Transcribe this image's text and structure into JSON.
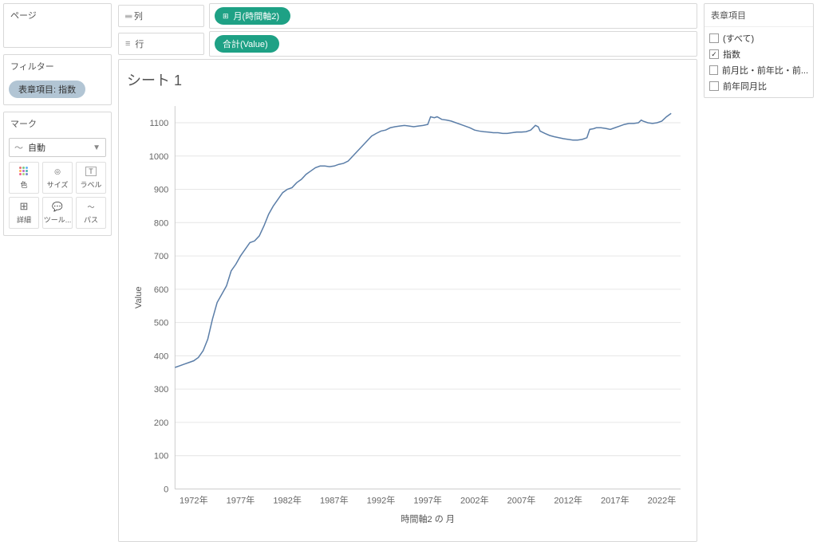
{
  "left": {
    "pages_title": "ページ",
    "filters_title": "フィルター",
    "filter_value": "表章項目: 指数",
    "marks_title": "マーク",
    "marks_select_label": "自動",
    "marks_cells": [
      "色",
      "サイズ",
      "ラベル",
      "詳細",
      "ツール...",
      "パス"
    ]
  },
  "shelves": {
    "columns_label": "列",
    "columns_pill": "月(時間軸2)",
    "rows_label": "行",
    "rows_pill": "合計(Value)"
  },
  "sheet": {
    "title": "シート 1",
    "yaxis": "Value",
    "xaxis": "時間軸2 の 月"
  },
  "legend": {
    "title": "表章項目",
    "items": [
      {
        "label": "(すべて)",
        "checked": false
      },
      {
        "label": "指数",
        "checked": true
      },
      {
        "label": "前月比・前年比・前...",
        "checked": false
      },
      {
        "label": "前年同月比",
        "checked": false
      }
    ]
  },
  "chart_data": {
    "type": "line",
    "ylabel": "Value",
    "xlabel": "時間軸2 の 月",
    "ylim": [
      0,
      1150
    ],
    "yticks": [
      0,
      100,
      200,
      300,
      400,
      500,
      600,
      700,
      800,
      900,
      1000,
      1100
    ],
    "xticks": [
      "1972年",
      "1977年",
      "1982年",
      "1987年",
      "1992年",
      "1997年",
      "2002年",
      "2007年",
      "2012年",
      "2017年",
      "2022年"
    ],
    "x_start_year": 1970,
    "x_end_year": 2024,
    "series": [
      {
        "name": "指数",
        "color": "#5b7ea8",
        "points": [
          {
            "year": 1970.0,
            "val": 365
          },
          {
            "year": 1970.5,
            "val": 370
          },
          {
            "year": 1971.0,
            "val": 375
          },
          {
            "year": 1971.5,
            "val": 380
          },
          {
            "year": 1972.0,
            "val": 385
          },
          {
            "year": 1972.5,
            "val": 395
          },
          {
            "year": 1973.0,
            "val": 415
          },
          {
            "year": 1973.5,
            "val": 450
          },
          {
            "year": 1974.0,
            "val": 510
          },
          {
            "year": 1974.5,
            "val": 560
          },
          {
            "year": 1975.0,
            "val": 585
          },
          {
            "year": 1975.5,
            "val": 610
          },
          {
            "year": 1976.0,
            "val": 655
          },
          {
            "year": 1976.5,
            "val": 675
          },
          {
            "year": 1977.0,
            "val": 700
          },
          {
            "year": 1977.5,
            "val": 720
          },
          {
            "year": 1978.0,
            "val": 740
          },
          {
            "year": 1978.5,
            "val": 745
          },
          {
            "year": 1979.0,
            "val": 760
          },
          {
            "year": 1979.5,
            "val": 790
          },
          {
            "year": 1980.0,
            "val": 825
          },
          {
            "year": 1980.5,
            "val": 850
          },
          {
            "year": 1981.0,
            "val": 870
          },
          {
            "year": 1981.5,
            "val": 890
          },
          {
            "year": 1982.0,
            "val": 900
          },
          {
            "year": 1982.5,
            "val": 905
          },
          {
            "year": 1983.0,
            "val": 920
          },
          {
            "year": 1983.5,
            "val": 930
          },
          {
            "year": 1984.0,
            "val": 945
          },
          {
            "year": 1984.5,
            "val": 955
          },
          {
            "year": 1985.0,
            "val": 965
          },
          {
            "year": 1985.5,
            "val": 970
          },
          {
            "year": 1986.0,
            "val": 970
          },
          {
            "year": 1986.5,
            "val": 968
          },
          {
            "year": 1987.0,
            "val": 970
          },
          {
            "year": 1987.5,
            "val": 975
          },
          {
            "year": 1988.0,
            "val": 978
          },
          {
            "year": 1988.5,
            "val": 985
          },
          {
            "year": 1989.0,
            "val": 1000
          },
          {
            "year": 1989.5,
            "val": 1015
          },
          {
            "year": 1990.0,
            "val": 1030
          },
          {
            "year": 1990.5,
            "val": 1045
          },
          {
            "year": 1991.0,
            "val": 1060
          },
          {
            "year": 1991.5,
            "val": 1068
          },
          {
            "year": 1992.0,
            "val": 1075
          },
          {
            "year": 1992.5,
            "val": 1078
          },
          {
            "year": 1993.0,
            "val": 1085
          },
          {
            "year": 1993.5,
            "val": 1088
          },
          {
            "year": 1994.0,
            "val": 1090
          },
          {
            "year": 1994.5,
            "val": 1092
          },
          {
            "year": 1995.0,
            "val": 1090
          },
          {
            "year": 1995.5,
            "val": 1088
          },
          {
            "year": 1996.0,
            "val": 1090
          },
          {
            "year": 1996.5,
            "val": 1092
          },
          {
            "year": 1997.0,
            "val": 1095
          },
          {
            "year": 1997.3,
            "val": 1118
          },
          {
            "year": 1997.7,
            "val": 1115
          },
          {
            "year": 1998.0,
            "val": 1118
          },
          {
            "year": 1998.5,
            "val": 1110
          },
          {
            "year": 1999.0,
            "val": 1108
          },
          {
            "year": 1999.5,
            "val": 1105
          },
          {
            "year": 2000.0,
            "val": 1100
          },
          {
            "year": 2000.5,
            "val": 1095
          },
          {
            "year": 2001.0,
            "val": 1090
          },
          {
            "year": 2001.5,
            "val": 1085
          },
          {
            "year": 2002.0,
            "val": 1078
          },
          {
            "year": 2002.5,
            "val": 1075
          },
          {
            "year": 2003.0,
            "val": 1073
          },
          {
            "year": 2003.5,
            "val": 1072
          },
          {
            "year": 2004.0,
            "val": 1070
          },
          {
            "year": 2004.5,
            "val": 1070
          },
          {
            "year": 2005.0,
            "val": 1068
          },
          {
            "year": 2005.5,
            "val": 1068
          },
          {
            "year": 2006.0,
            "val": 1070
          },
          {
            "year": 2006.5,
            "val": 1072
          },
          {
            "year": 2007.0,
            "val": 1072
          },
          {
            "year": 2007.5,
            "val": 1073
          },
          {
            "year": 2008.0,
            "val": 1078
          },
          {
            "year": 2008.5,
            "val": 1092
          },
          {
            "year": 2008.8,
            "val": 1088
          },
          {
            "year": 2009.0,
            "val": 1075
          },
          {
            "year": 2009.5,
            "val": 1068
          },
          {
            "year": 2010.0,
            "val": 1062
          },
          {
            "year": 2010.5,
            "val": 1058
          },
          {
            "year": 2011.0,
            "val": 1055
          },
          {
            "year": 2011.5,
            "val": 1052
          },
          {
            "year": 2012.0,
            "val": 1050
          },
          {
            "year": 2012.5,
            "val": 1048
          },
          {
            "year": 2013.0,
            "val": 1048
          },
          {
            "year": 2013.5,
            "val": 1050
          },
          {
            "year": 2014.0,
            "val": 1055
          },
          {
            "year": 2014.3,
            "val": 1080
          },
          {
            "year": 2014.7,
            "val": 1082
          },
          {
            "year": 2015.0,
            "val": 1085
          },
          {
            "year": 2015.5,
            "val": 1085
          },
          {
            "year": 2016.0,
            "val": 1083
          },
          {
            "year": 2016.5,
            "val": 1080
          },
          {
            "year": 2017.0,
            "val": 1085
          },
          {
            "year": 2017.5,
            "val": 1090
          },
          {
            "year": 2018.0,
            "val": 1095
          },
          {
            "year": 2018.5,
            "val": 1098
          },
          {
            "year": 2019.0,
            "val": 1098
          },
          {
            "year": 2019.5,
            "val": 1100
          },
          {
            "year": 2019.8,
            "val": 1108
          },
          {
            "year": 2020.0,
            "val": 1105
          },
          {
            "year": 2020.5,
            "val": 1100
          },
          {
            "year": 2021.0,
            "val": 1098
          },
          {
            "year": 2021.5,
            "val": 1100
          },
          {
            "year": 2022.0,
            "val": 1105
          },
          {
            "year": 2022.5,
            "val": 1118
          },
          {
            "year": 2023.0,
            "val": 1128
          }
        ]
      }
    ]
  }
}
